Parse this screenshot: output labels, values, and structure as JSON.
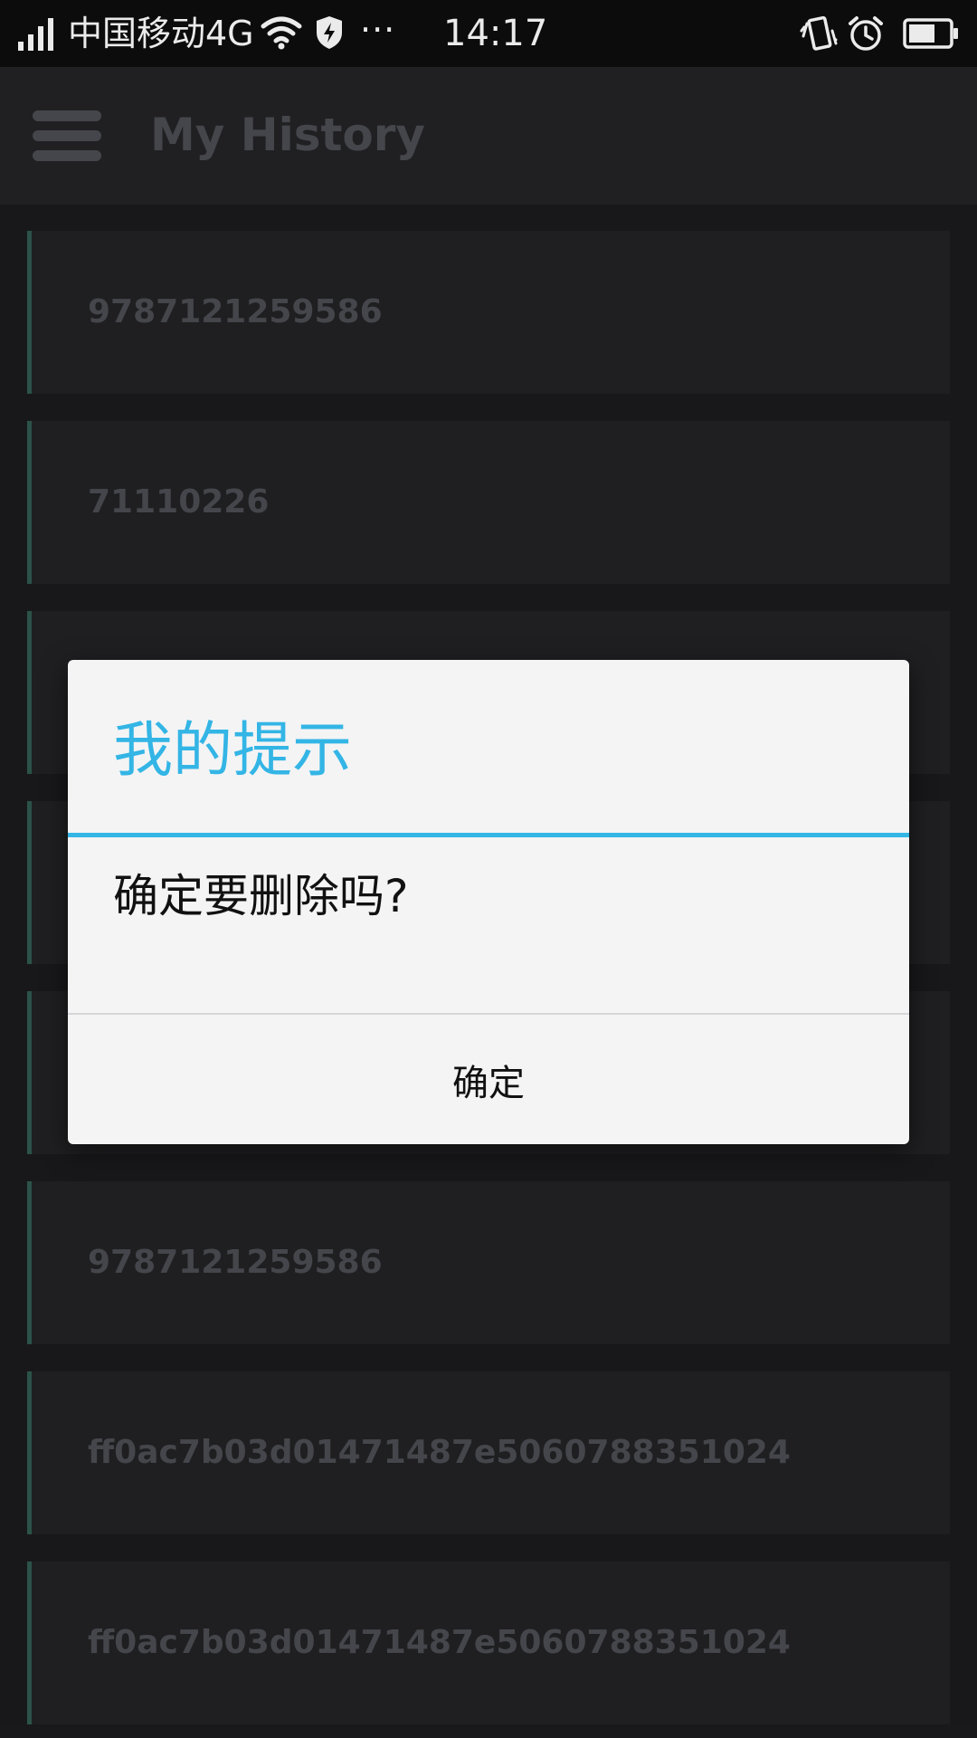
{
  "status_bar": {
    "carrier": "中国移动4G",
    "more": "···",
    "time": "14:17",
    "icons": [
      "signal-icon",
      "wifi-icon",
      "shield-icon",
      "vibrate-icon",
      "alarm-icon",
      "battery-icon"
    ]
  },
  "app_bar": {
    "title": "My History",
    "menu_icon": "hamburger-menu-icon"
  },
  "history": {
    "items": [
      "9787121259586",
      "71110226",
      "",
      "",
      "",
      "9787121259586",
      "ff0ac7b03d01471487e5060788351024",
      "ff0ac7b03d01471487e5060788351024"
    ]
  },
  "dialog": {
    "title": "我的提示",
    "message": "确定要删除吗?",
    "confirm_label": "确定"
  },
  "colors": {
    "accent": "#33b5e5",
    "background": "#1b1b1d",
    "item_background": "#222224",
    "item_border": "#2f5a4f",
    "muted_text": "#4b4d52"
  }
}
